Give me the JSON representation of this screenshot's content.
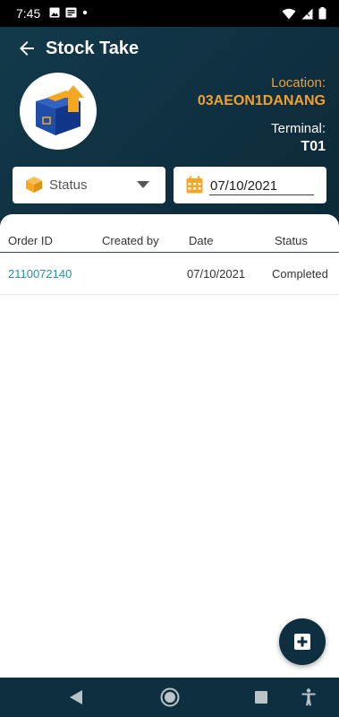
{
  "status_bar": {
    "time": "7:45",
    "left_icons": [
      "image-icon",
      "message-icon",
      "dot-icon"
    ],
    "right_icons": [
      "wifi-icon",
      "signal-icon",
      "battery-icon"
    ]
  },
  "header": {
    "title": "Stock Take",
    "location_label": "Location:",
    "location_value": "03AEON1DANANG",
    "terminal_label": "Terminal:",
    "terminal_value": "T01"
  },
  "filters": {
    "status_placeholder": "Status",
    "date_value": "07/10/2021"
  },
  "table": {
    "columns": [
      "Order ID",
      "Created by",
      "Date",
      "Status"
    ],
    "rows": [
      {
        "order_id": "2110072140",
        "created_by": "",
        "date": "07/10/2021",
        "status": "Completed"
      }
    ]
  },
  "fab": {
    "icon": "add-box-icon"
  },
  "nav": {
    "icons": [
      "back-triangle-icon",
      "home-circle-icon",
      "recents-square-icon",
      "accessibility-icon"
    ]
  },
  "colors": {
    "header_bg": "#0f3041",
    "accent_orange": "#f0a030",
    "link_teal": "#2a8fa3",
    "nav_bg": "#0e2f3f"
  }
}
